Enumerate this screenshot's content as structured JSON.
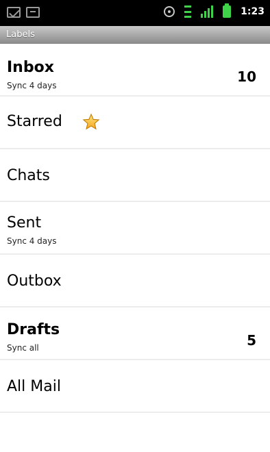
{
  "status_bar": {
    "time": "1:23",
    "icons": [
      "mail-notification-icon",
      "calendar-notification-icon",
      "gps-icon",
      "data-transfer-icon",
      "signal-icon",
      "battery-icon"
    ]
  },
  "title_bar": {
    "title": "Labels"
  },
  "labels": [
    {
      "name": "Inbox",
      "bold": true,
      "sync": "Sync 4 days",
      "count": "10"
    },
    {
      "name": "Starred",
      "bold": false,
      "icon": "star-icon"
    },
    {
      "name": "Chats",
      "bold": false
    },
    {
      "name": "Sent",
      "bold": false,
      "sync": "Sync 4 days"
    },
    {
      "name": "Outbox",
      "bold": false
    },
    {
      "name": "Drafts",
      "bold": true,
      "sync": "Sync all",
      "count": "5"
    },
    {
      "name": "All Mail",
      "bold": false
    }
  ]
}
